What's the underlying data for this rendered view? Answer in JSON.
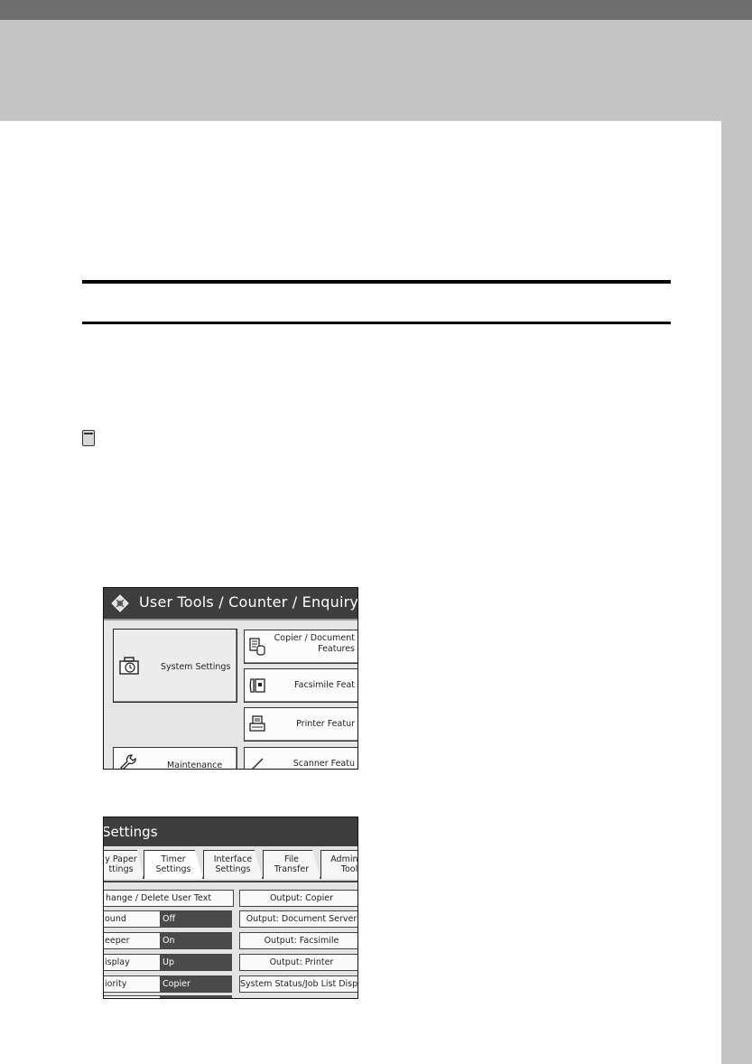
{
  "screen1": {
    "title": "User Tools / Counter / Enquiry",
    "buttons": {
      "system_settings": "System Settings",
      "copier_line1": "Copier / Document",
      "copier_line2": "Features",
      "facsimile": "Facsimile Feat",
      "printer": "Printer Featur",
      "maintenance": "Maintenance",
      "scanner": "Scanner Featu"
    }
  },
  "screen2": {
    "title": "Settings",
    "tabs": [
      {
        "line1": "y Paper",
        "line2": "ttings"
      },
      {
        "line1": "Timer",
        "line2": "Settings"
      },
      {
        "line1": "Interface",
        "line2": "Settings"
      },
      {
        "line1": "File",
        "line2": "Transfer"
      },
      {
        "line1": "Administ",
        "line2": "Tool"
      }
    ],
    "left_rows": [
      {
        "label": "hange / Delete User Text"
      },
      {
        "label": "ound",
        "value": "Off"
      },
      {
        "label": "eeper",
        "value": "On"
      },
      {
        "label": "isplay",
        "value": "Up"
      },
      {
        "label": "iority",
        "value": "Copier"
      }
    ],
    "right_rows": [
      "Output: Copier",
      "Output: Document Server",
      "Output: Facsimile",
      "Output: Printer",
      "System Status/Job List Display"
    ]
  }
}
